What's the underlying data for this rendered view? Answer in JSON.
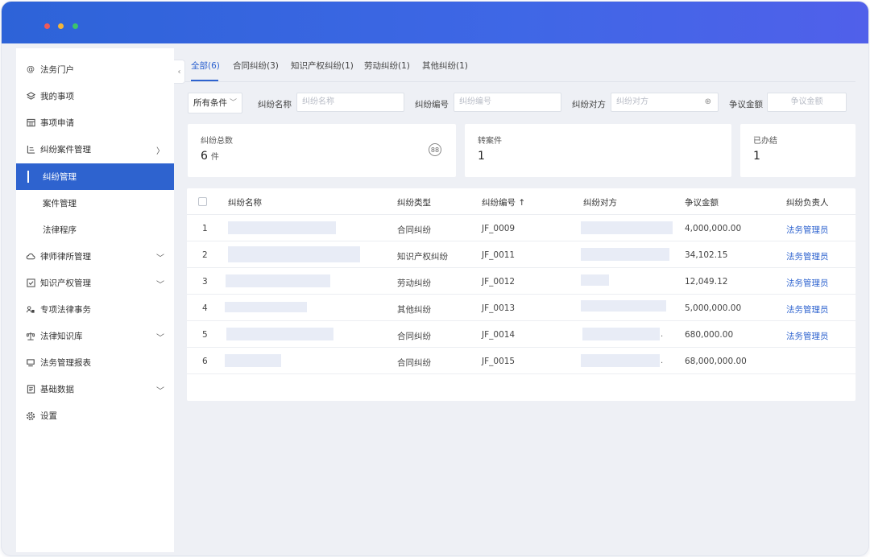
{
  "window": {
    "controls": [
      "close",
      "minimize",
      "maximize"
    ]
  },
  "sidebar": {
    "items": [
      {
        "label": "法务门户",
        "icon": "at-icon"
      },
      {
        "label": "我的事项",
        "icon": "layers-icon"
      },
      {
        "label": "事项申请",
        "icon": "calendar-grid-icon"
      },
      {
        "label": "纠纷案件管理",
        "icon": "list-icon",
        "expanded": true
      },
      {
        "label": "纠纷管理",
        "sub": true,
        "active": true
      },
      {
        "label": "案件管理",
        "sub": true
      },
      {
        "label": "法律程序",
        "sub": true
      },
      {
        "label": "律师律所管理",
        "icon": "cloud-icon",
        "chevron": "down"
      },
      {
        "label": "知识产权管理",
        "icon": "check-box-icon",
        "chevron": "down"
      },
      {
        "label": "专项法律事务",
        "icon": "people-icon"
      },
      {
        "label": "法律知识库",
        "icon": "scale-icon",
        "chevron": "down"
      },
      {
        "label": "法务管理报表",
        "icon": "monitor-icon"
      },
      {
        "label": "基础数据",
        "icon": "document-icon",
        "chevron": "down"
      },
      {
        "label": "设置",
        "icon": "gear-icon"
      }
    ]
  },
  "tabs": [
    {
      "label": "全部(6)",
      "active": true
    },
    {
      "label": "合同纠纷(3)"
    },
    {
      "label": "知识产权纠纷(1)"
    },
    {
      "label": "劳动纠纷(1)"
    },
    {
      "label": "其他纠纷(1)"
    }
  ],
  "filters": {
    "condition": "所有条件",
    "name_label": "纠纷名称",
    "name_placeholder": "纠纷名称",
    "number_label": "纠纷编号",
    "number_placeholder": "纠纷编号",
    "party_label": "纠纷对方",
    "party_placeholder": "纠纷对方",
    "amount_label": "争议金额",
    "amount_placeholder": "争议金额"
  },
  "stats": [
    {
      "label": "纠纷总数",
      "value": "6",
      "unit": "件"
    },
    {
      "label": "转案件",
      "value": "1"
    },
    {
      "label": "已办结",
      "value": "1"
    }
  ],
  "table": {
    "columns": [
      "纠纷名称",
      "纠纷类型",
      "纠纷编号 ↑",
      "纠纷对方",
      "争议金额",
      "纠纷负责人"
    ],
    "rows": [
      {
        "index": "1",
        "type": "合同纠纷",
        "number": "JF_0009",
        "amount": "4,000,000.00",
        "owner": "法务管理员"
      },
      {
        "index": "2",
        "type": "知识产权纠纷",
        "number": "JF_0011",
        "amount": "34,102.15",
        "owner": "法务管理员"
      },
      {
        "index": "3",
        "type": "劳动纠纷",
        "number": "JF_0012",
        "amount": "12,049.12",
        "owner": "法务管理员"
      },
      {
        "index": "4",
        "type": "其他纠纷",
        "number": "JF_0013",
        "amount": "5,000,000.00",
        "owner": "法务管理员"
      },
      {
        "index": "5",
        "type": "合同纠纷",
        "number": "JF_0014",
        "amount": "680,000.00",
        "owner": "法务管理员",
        "party_suffix": "."
      },
      {
        "index": "6",
        "type": "合同纠纷",
        "number": "JF_0015",
        "amount": "68,000,000.00",
        "owner": "",
        "party_suffix": "."
      }
    ]
  }
}
